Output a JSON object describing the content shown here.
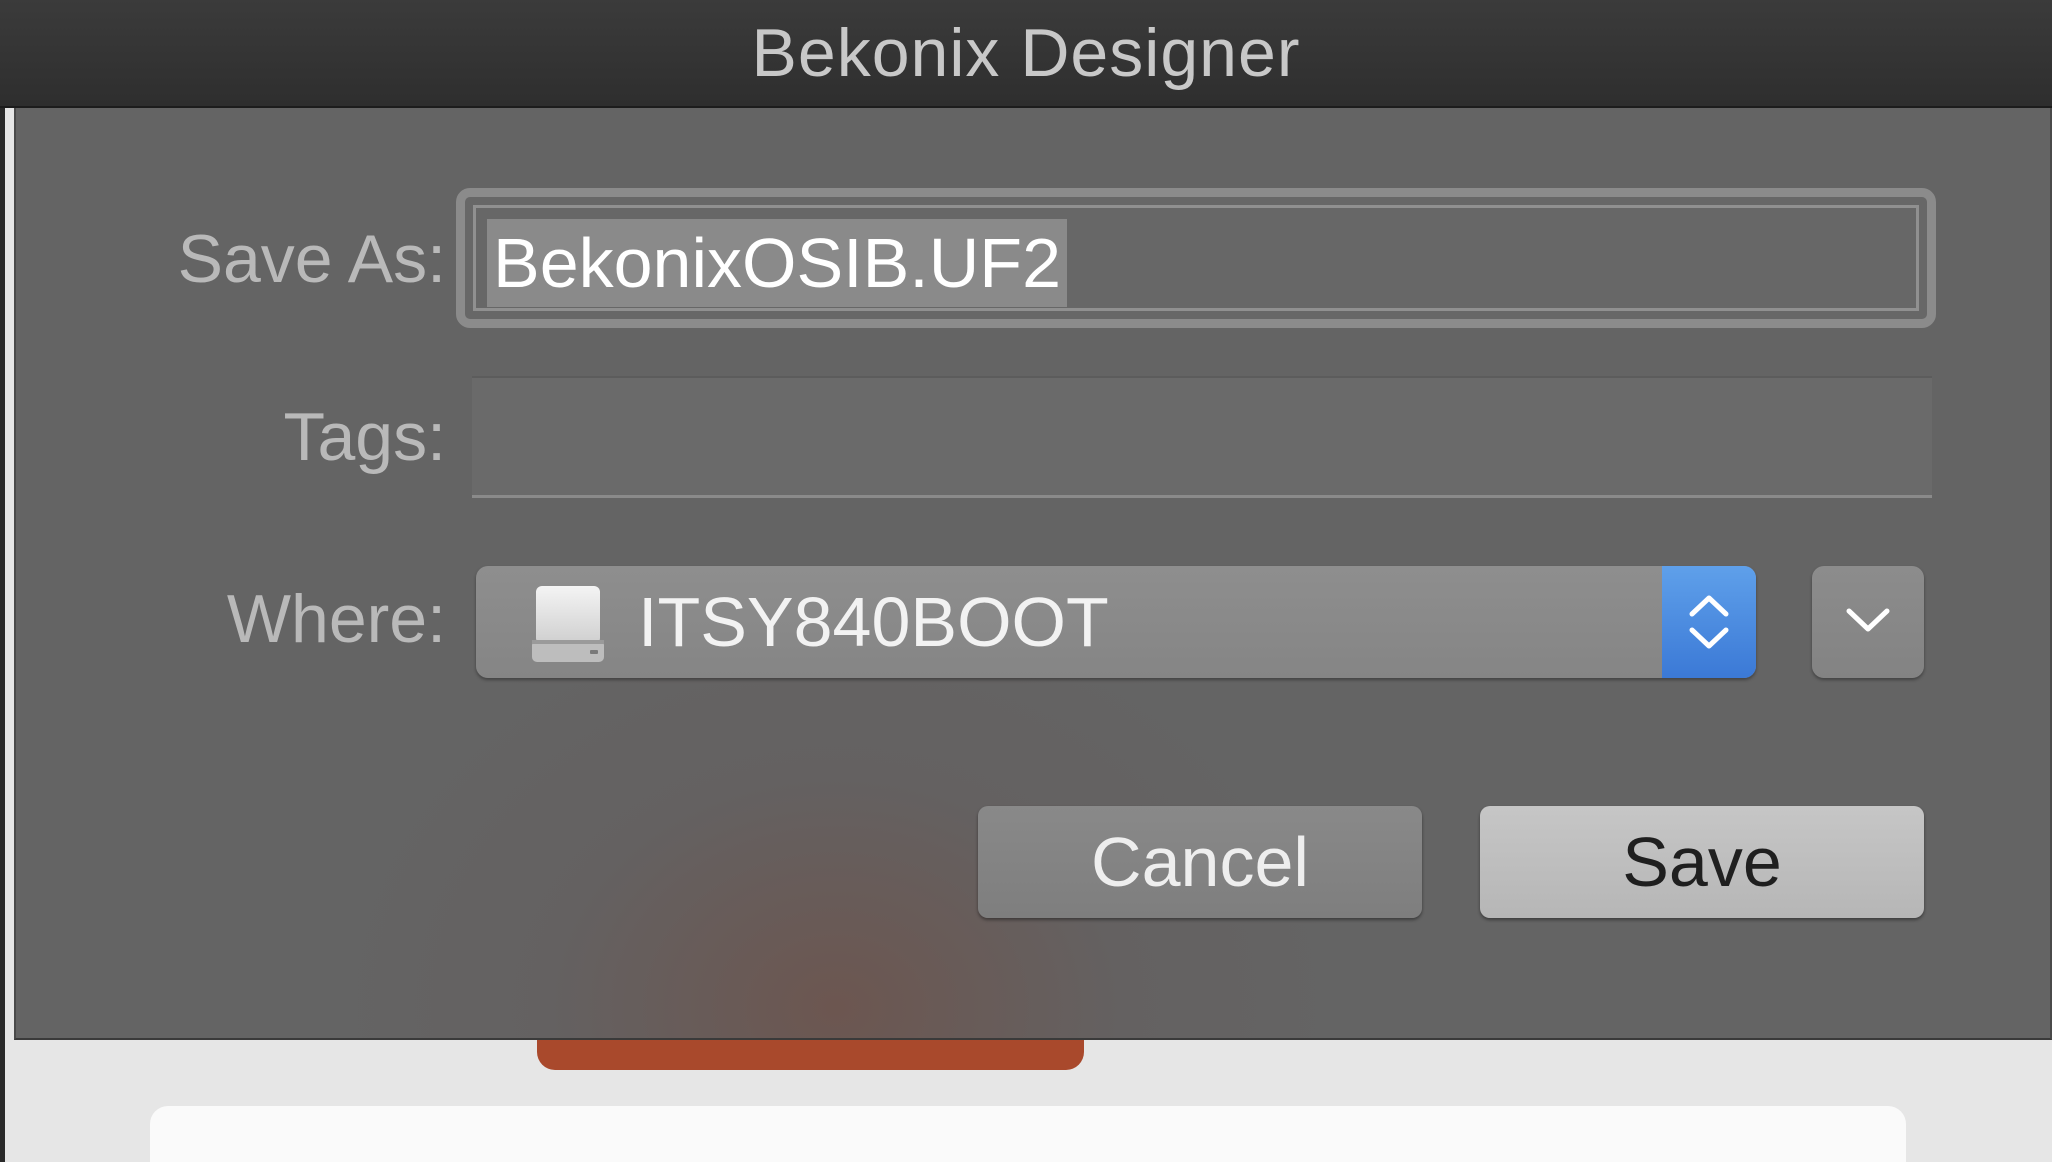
{
  "window": {
    "title": "Bekonix Designer"
  },
  "dialog": {
    "save_as_label": "Save As:",
    "save_as_value": "BekonixOSIB.UF2",
    "tags_label": "Tags:",
    "tags_value": "",
    "where_label": "Where:",
    "where_value": "ITSY840BOOT",
    "where_icon": "external-drive-icon",
    "cancel_label": "Cancel",
    "save_label": "Save"
  },
  "colors": {
    "titlebar": "#2e2e2e",
    "sheet": "#646464",
    "accent_stepper": "#3b79d6",
    "background_orange": "#a9492c"
  }
}
